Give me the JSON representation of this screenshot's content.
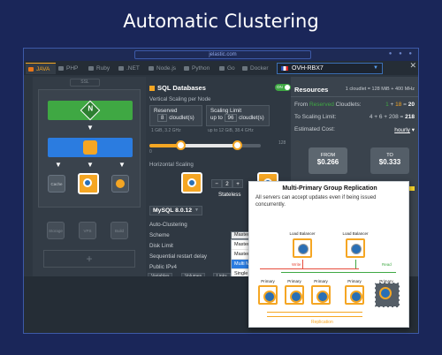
{
  "banner": {
    "title": "Automatic Clustering"
  },
  "browser": {
    "address": "jelastic.com"
  },
  "tabs": [
    {
      "label": "JAVA",
      "active": true
    },
    {
      "label": "PHP"
    },
    {
      "label": "Ruby"
    },
    {
      "label": ".NET"
    },
    {
      "label": "Node.js"
    },
    {
      "label": "Python"
    },
    {
      "label": "Go"
    },
    {
      "label": "Docker"
    }
  ],
  "environment": {
    "name": "OVH-RBX7"
  },
  "topology": {
    "ssl_label": "SSL",
    "nodes": [
      {
        "label": "Cache"
      },
      {
        "label": ""
      },
      {
        "label": ""
      },
      {
        "label": "Storage"
      },
      {
        "label": "VPS"
      },
      {
        "label": "Build"
      }
    ],
    "add_symbol": "+"
  },
  "config": {
    "section_title": "SQL Databases",
    "toggle_label": "ON",
    "vertical_scaling_label": "Vertical Scaling per Node",
    "reserved": {
      "title": "Reserved",
      "value": "8",
      "unit": "cloudlet(s)",
      "sub": "1 GiB, 3.2 GHz"
    },
    "scaling_limit": {
      "title": "Scaling Limit",
      "prefix": "up to",
      "value": "96",
      "unit": "cloudlet(s)",
      "sub": "up to 12 GiB, 38.4 GHz"
    },
    "slider_left_val": "0",
    "slider_right_val": "128",
    "horizontal_scaling_label": "Horizontal Scaling",
    "node_count": "2",
    "minus": "−",
    "plus": "+",
    "stateless_label": "Stateless",
    "version": "MySQL 8.0.12",
    "auto_clustering_label": "Auto-Clustering",
    "auto_clustering_toggle": "ON",
    "scheme_label": "Scheme",
    "scheme_value": "Master-Slave",
    "scheme_options": [
      "Master-Master",
      "Master-Slave",
      "Multi MGR",
      "Single MGR"
    ],
    "disk_limit_label": "Disk Limit",
    "sequential_restart_label": "Sequential restart delay",
    "public_ipv4_label": "Public IPv4",
    "bottom_buttons": [
      "Variables",
      "Volumes",
      "Links"
    ]
  },
  "resources": {
    "title": "Resources",
    "cloudlet_note": "1 cloudlet = 128 MiB + 400 MHz",
    "from_reserved": {
      "label": "From",
      "label_hl": "Reserved",
      "label_suffix": "Cloudlets:",
      "a": "1",
      "b": "18",
      "result": "20"
    },
    "to_scaling": {
      "label": "To Scaling Limit:",
      "expr": "4 + 6 + 208 =",
      "result": "218"
    },
    "estimated_cost_label": "Estimated Cost:",
    "period": "hourly",
    "from_price": {
      "title": "FROM",
      "value": "$0.266"
    },
    "to_price": {
      "title": "TO",
      "value": "$0.333"
    }
  },
  "popover": {
    "title": "Multi-Primary Group Replication",
    "description": "All servers can accept updates even if being issued concurrently.",
    "load_balancers": [
      "Load Balancer",
      "Load Balancer"
    ],
    "primaries": [
      "Primary",
      "Primary",
      "Primary",
      "Primary",
      "Primary"
    ],
    "write_label": "Write",
    "read_label": "Read",
    "replication_label": "Replication"
  },
  "colors": {
    "background": "#1a2659",
    "accent_orange": "#f5a623",
    "accent_green": "#3fa843",
    "accent_blue": "#2b7ce0"
  }
}
